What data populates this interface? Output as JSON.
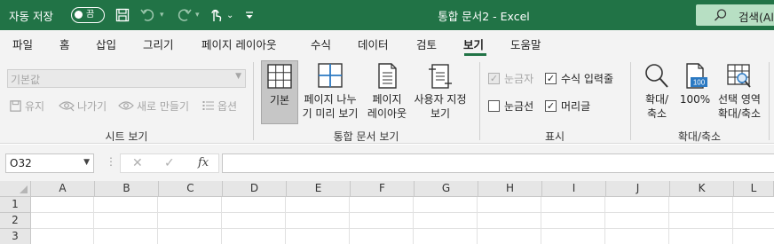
{
  "titlebar": {
    "autosave_label": "자동 저장",
    "autosave_state": "끔",
    "document_title": "통합 문서2  -  Excel",
    "search_text": "검색(Al"
  },
  "tabs": [
    "파일",
    "홈",
    "삽입",
    "그리기",
    "페이지 레이아웃",
    "수식",
    "데이터",
    "검토",
    "보기",
    "도움말"
  ],
  "active_tab": "보기",
  "ribbon": {
    "sheet_view": {
      "dropdown_value": "기본값",
      "keep": "유지",
      "exit": "나가기",
      "new": "새로 만들기",
      "options": "옵션",
      "label": "시트 보기"
    },
    "workbook_views": {
      "normal": "기본",
      "page_break_preview_l1": "페이지 나누",
      "page_break_preview_l2": "기 미리 보기",
      "page_layout_l1": "페이지",
      "page_layout_l2": "레이아웃",
      "custom_views_l1": "사용자 지정",
      "custom_views_l2": "보기",
      "label": "통합 문서 보기"
    },
    "show": {
      "ruler": "눈금자",
      "gridlines": "눈금선",
      "formula_bar": "수식 입력줄",
      "headings": "머리글",
      "label": "표시"
    },
    "zoom": {
      "zoom_l1": "확대/",
      "zoom_l2": "축소",
      "hundred": "100%",
      "hundred_icon_text": "100",
      "zoom_selection_l1": "선택 영역",
      "zoom_selection_l2": "확대/축소",
      "label": "확대/축소"
    }
  },
  "formula_bar": {
    "name_box": "O32",
    "fx": "fx"
  },
  "columns": [
    "A",
    "B",
    "C",
    "D",
    "E",
    "F",
    "G",
    "H",
    "I",
    "J",
    "K",
    "L"
  ],
  "rows": [
    "1",
    "2",
    "3"
  ],
  "colors": {
    "brand": "#217346",
    "ribbon_bg": "#f3f3f3",
    "search_bg": "#b7dfc3"
  }
}
